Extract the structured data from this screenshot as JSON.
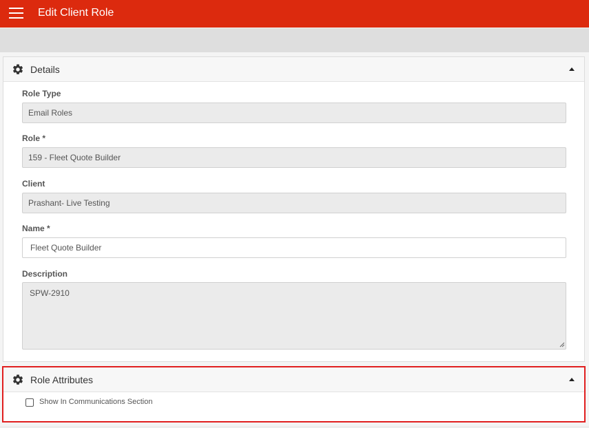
{
  "header": {
    "title": "Edit Client Role",
    "menu_icon": "hamburger-menu-icon",
    "background_color": "#dc2a0e"
  },
  "details_panel": {
    "title": "Details",
    "icon": "gear-icon",
    "collapse_icon": "caret-up-icon",
    "fields": {
      "role_type": {
        "label": "Role Type",
        "value": "Email Roles"
      },
      "role": {
        "label": "Role *",
        "value": "159 - Fleet Quote Builder"
      },
      "client": {
        "label": "Client",
        "value": "Prashant- Live Testing"
      },
      "name": {
        "label": "Name *",
        "value": "Fleet Quote Builder"
      },
      "description": {
        "label": "Description",
        "value": "SPW-2910"
      }
    }
  },
  "attributes_panel": {
    "title": "Role Attributes",
    "icon": "gear-icon",
    "collapse_icon": "caret-up-icon",
    "highlight_color": "#e01e1e",
    "checkbox": {
      "label": "Show In Communications Section",
      "checked": false
    }
  }
}
